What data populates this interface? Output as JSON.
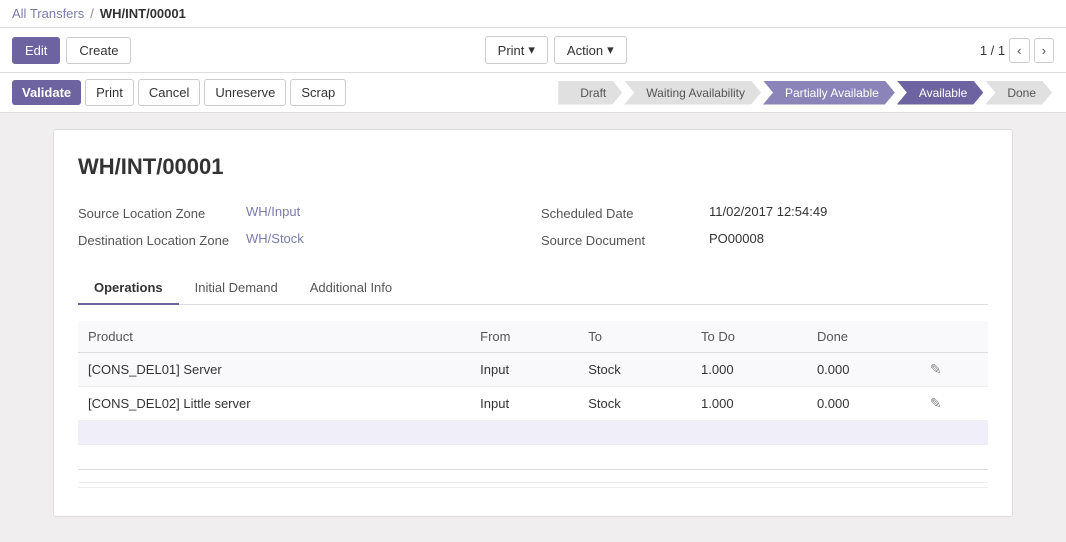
{
  "breadcrumb": {
    "parent_label": "All Transfers",
    "separator": "/",
    "current": "WH/INT/00001"
  },
  "toolbar": {
    "edit_label": "Edit",
    "create_label": "Create",
    "print_label": "Print",
    "action_label": "Action",
    "dropdown_arrow": "▾",
    "pagination": "1 / 1"
  },
  "status_bar": {
    "validate_label": "Validate",
    "print_label": "Print",
    "cancel_label": "Cancel",
    "unreserve_label": "Unreserve",
    "scrap_label": "Scrap",
    "pipeline": [
      {
        "label": "Draft",
        "state": "normal"
      },
      {
        "label": "Waiting Availability",
        "state": "normal"
      },
      {
        "label": "Partially Available",
        "state": "semi-active"
      },
      {
        "label": "Available",
        "state": "active"
      },
      {
        "label": "Done",
        "state": "normal"
      }
    ]
  },
  "document": {
    "title": "WH/INT/00001",
    "source_location_zone_label": "Source Location Zone",
    "source_location_zone_value": "WH/Input",
    "destination_location_zone_label": "Destination Location Zone",
    "destination_location_zone_value": "WH/Stock",
    "scheduled_date_label": "Scheduled Date",
    "scheduled_date_value": "11/02/2017 12:54:49",
    "source_document_label": "Source Document",
    "source_document_value": "PO00008"
  },
  "tabs": [
    {
      "id": "operations",
      "label": "Operations",
      "active": true
    },
    {
      "id": "initial-demand",
      "label": "Initial Demand",
      "active": false
    },
    {
      "id": "additional-info",
      "label": "Additional Info",
      "active": false
    }
  ],
  "table": {
    "headers": [
      "Product",
      "From",
      "To",
      "To Do",
      "Done",
      ""
    ],
    "rows": [
      {
        "product": "[CONS_DEL01] Server",
        "from": "Input",
        "to": "Stock",
        "todo": "1.000",
        "done": "0.000"
      },
      {
        "product": "[CONS_DEL02] Little server",
        "from": "Input",
        "to": "Stock",
        "todo": "1.000",
        "done": "0.000"
      }
    ]
  }
}
